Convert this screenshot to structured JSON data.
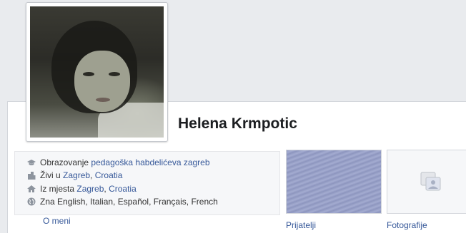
{
  "profile": {
    "name": "Helena Krmpotic"
  },
  "intro": {
    "education": {
      "prefix": "Obrazovanje",
      "link": "pedagoška habdelićeva zagreb"
    },
    "lives": {
      "prefix": "Živi u",
      "link1": "Zagreb",
      "sep": ",",
      "link2": "Croatia"
    },
    "from": {
      "prefix": "Iz mjesta",
      "link1": "Zagreb",
      "sep": ",",
      "link2": "Croatia"
    },
    "languages": {
      "text": "Zna English, Italian, Español, Français, French"
    }
  },
  "about_link": "O meni",
  "tiles": {
    "friends": "Prijatelji",
    "photos": "Fotografije"
  },
  "colors": {
    "link": "#365899",
    "background": "#e9ebee",
    "name": "#1c1e21"
  }
}
